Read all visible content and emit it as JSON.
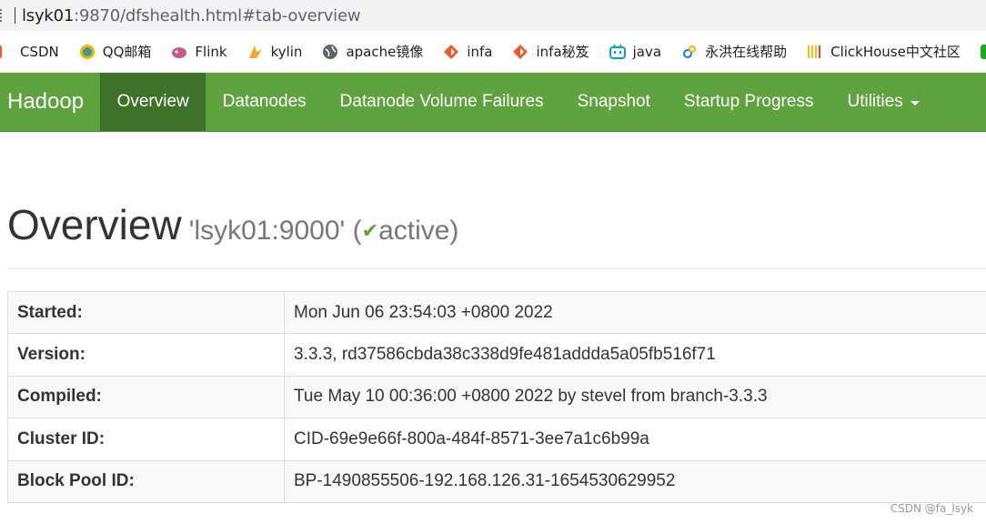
{
  "browser": {
    "url_host": "lsyk01",
    "url_rest": ":9870/dfshealth.html#tab-overview"
  },
  "bookmarks": [
    {
      "label": "CSDN",
      "icon": "csdn-icon"
    },
    {
      "label": "QQ邮箱",
      "icon": "qq-mail-icon"
    },
    {
      "label": "Flink",
      "icon": "flink-icon"
    },
    {
      "label": "kylin",
      "icon": "kylin-icon"
    },
    {
      "label": "apache镜像",
      "icon": "globe-icon"
    },
    {
      "label": "infa",
      "icon": "infa-icon"
    },
    {
      "label": "infa秘笈",
      "icon": "infa-icon"
    },
    {
      "label": "java",
      "icon": "bilibili-icon"
    },
    {
      "label": "永洪在线帮助",
      "icon": "link-icon"
    },
    {
      "label": "ClickHouse中文社区",
      "icon": "clickhouse-icon"
    }
  ],
  "navbar": {
    "brand": "Hadoop",
    "items": [
      {
        "label": "Overview",
        "active": true
      },
      {
        "label": "Datanodes"
      },
      {
        "label": "Datanode Volume Failures"
      },
      {
        "label": "Snapshot"
      },
      {
        "label": "Startup Progress"
      },
      {
        "label": "Utilities"
      }
    ]
  },
  "header": {
    "title": "Overview",
    "node": "'lsyk01:9000'",
    "state_open": "(",
    "state_check": "✔",
    "state_label": "active)"
  },
  "info": [
    {
      "key": "Started:",
      "value": "Mon Jun 06 23:54:03 +0800 2022"
    },
    {
      "key": "Version:",
      "value": "3.3.3, rd37586cbda38c338d9fe481addda5a05fb516f71"
    },
    {
      "key": "Compiled:",
      "value": "Tue May 10 00:36:00 +0800 2022 by stevel from branch-3.3.3"
    },
    {
      "key": "Cluster ID:",
      "value": "CID-69e9e66f-800a-484f-8571-3ee7a1c6b99a"
    },
    {
      "key": "Block Pool ID:",
      "value": "BP-1490855506-192.168.126.31-1654530629952"
    }
  ],
  "watermark": "CSDN @fa_lsyk",
  "colors": {
    "navbar": "#5fa33e",
    "navbar_active": "#3d7328",
    "check": "#5fa33e"
  }
}
